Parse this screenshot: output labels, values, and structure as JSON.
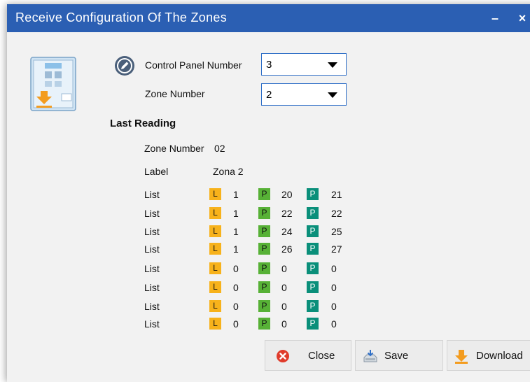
{
  "window": {
    "title": "Receive Configuration Of The Zones",
    "minimize": "–",
    "close": "×"
  },
  "form": {
    "control_panel_label": "Control Panel Number",
    "control_panel_value": "3",
    "zone_number_label": "Zone Number",
    "zone_number_value": "2"
  },
  "last_reading": {
    "title": "Last Reading",
    "zone_number_label": "Zone Number",
    "zone_number_value": "02",
    "label_label": "Label",
    "label_value": "Zona 2",
    "badges": {
      "l": "L",
      "p": "P"
    },
    "rows": [
      {
        "label": "List",
        "l": "1",
        "p1": "20",
        "p2": "21"
      },
      {
        "label": "List",
        "l": "1",
        "p1": "22",
        "p2": "22"
      },
      {
        "label": "List",
        "l": "1",
        "p1": "24",
        "p2": "25"
      },
      {
        "label": "List",
        "l": "1",
        "p1": "26",
        "p2": "27"
      },
      {
        "label": "List",
        "l": "0",
        "p1": "0",
        "p2": "0"
      },
      {
        "label": "List",
        "l": "0",
        "p1": "0",
        "p2": "0"
      },
      {
        "label": "List",
        "l": "0",
        "p1": "0",
        "p2": "0"
      },
      {
        "label": "List",
        "l": "0",
        "p1": "0",
        "p2": "0"
      }
    ]
  },
  "buttons": {
    "close": "Close",
    "save": "Save",
    "download": "Download"
  },
  "icons": {
    "panel": "control-panel-download-icon",
    "edit": "edit-pencil-icon",
    "close": "close-circle-icon",
    "save": "save-tray-icon",
    "download": "download-arrow-icon"
  },
  "colors": {
    "titlebar": "#2b5fb3",
    "badge_l": "#f7b21b",
    "badge_p_green": "#57b136",
    "badge_p_teal": "#0a8f7a",
    "close_red": "#e03b2b",
    "download_orange": "#f39c1f"
  }
}
